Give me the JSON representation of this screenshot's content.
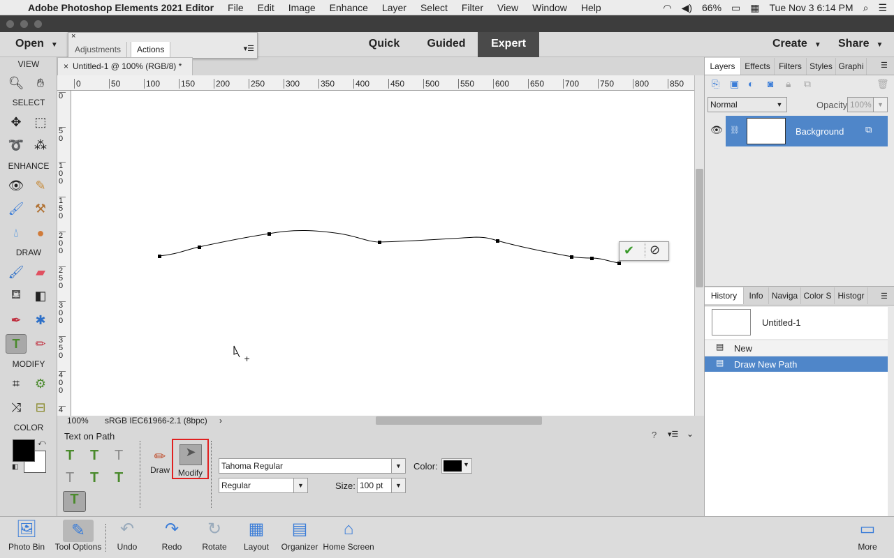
{
  "menubar": {
    "app_name": "Adobe Photoshop Elements 2021 Editor",
    "items": [
      "File",
      "Edit",
      "Image",
      "Enhance",
      "Layer",
      "Select",
      "Filter",
      "View",
      "Window",
      "Help"
    ],
    "battery": "66%",
    "clock": "Tue Nov 3  6:14 PM"
  },
  "header": {
    "open": "Open",
    "modes": [
      "Quick",
      "Guided",
      "Expert"
    ],
    "active_mode": "Expert",
    "create": "Create",
    "share": "Share"
  },
  "floating_panel": {
    "tabs": [
      "Adjustments",
      "Actions"
    ],
    "active": "Actions"
  },
  "toolbox": {
    "sections": [
      "VIEW",
      "SELECT",
      "ENHANCE",
      "DRAW",
      "MODIFY",
      "COLOR"
    ]
  },
  "document": {
    "tab_title": "Untitled-1 @ 100% (RGB/8) *",
    "ruler_top": [
      "0",
      "50",
      "100",
      "150",
      "200",
      "250",
      "300",
      "350",
      "400",
      "450",
      "500",
      "550",
      "600",
      "650",
      "700",
      "750",
      "800",
      "850"
    ],
    "ruler_left": [
      "0",
      "5 0",
      "1 0 0",
      "1 5 0",
      "2 0 0",
      "2 5 0",
      "3 0 0",
      "3 5 0",
      "4 0 0",
      "4"
    ],
    "zoom": "100%",
    "profile": "sRGB IEC61966-2.1 (8bpc)"
  },
  "layers_panel": {
    "tabs": [
      "Layers",
      "Effects",
      "Filters",
      "Styles",
      "Graphi"
    ],
    "blend_mode": "Normal",
    "opacity_label": "Opacity:",
    "opacity_value": "100%",
    "layer_name": "Background"
  },
  "history_panel": {
    "tabs": [
      "History",
      "Info",
      "Naviga",
      "Color S",
      "Histogr"
    ],
    "snapshot": "Untitled-1",
    "items": [
      "New",
      "Draw New Path"
    ]
  },
  "tool_options": {
    "title": "Text on Path",
    "draw_label": "Draw",
    "modify_label": "Modify",
    "font_family": "Tahoma Regular",
    "font_style": "Regular",
    "color_label": "Color:",
    "size_label": "Size:",
    "size_value": "100 pt"
  },
  "bottombar": {
    "items": [
      "Photo Bin",
      "Tool Options",
      "Undo",
      "Redo",
      "Rotate",
      "Layout",
      "Organizer",
      "Home Screen"
    ],
    "more": "More"
  },
  "colors": {
    "accent": "#3b7dd8",
    "selected_row": "#4f86c9",
    "modify_outline": "#e02020"
  }
}
